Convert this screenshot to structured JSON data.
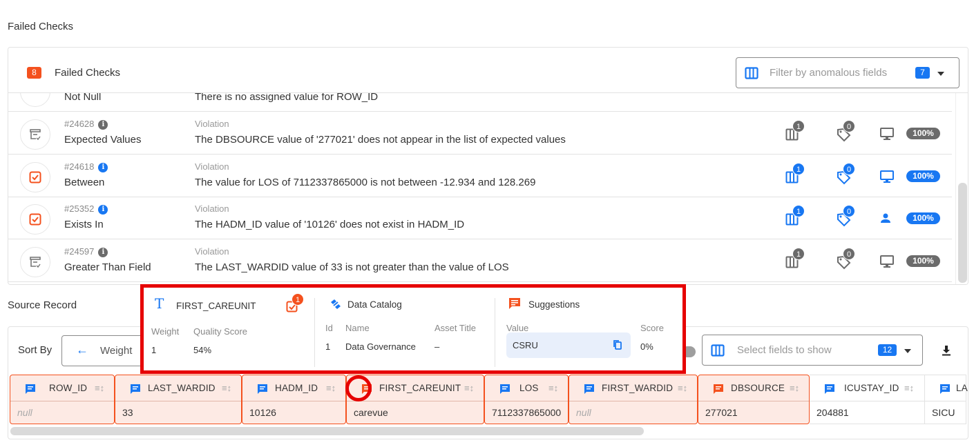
{
  "failed_checks_section": {
    "title": "Failed Checks",
    "header": {
      "count": "8",
      "title": "Failed Checks",
      "filter_placeholder": "Filter by anomalous fields",
      "filter_count": "7"
    },
    "partial_row": {
      "name": "Not Null",
      "violation": "There is no assigned value for ROW_ID"
    },
    "rows": [
      {
        "id": "#24628",
        "name": "Expected Values",
        "violation_label": "Violation",
        "violation": "The DBSOURCE value of '277021' does not appear in the list of expected values",
        "state": "inactive",
        "fields_count": "1",
        "tags_count": "0",
        "owner": "monitor-icon",
        "coverage": "100%"
      },
      {
        "id": "#24618",
        "name": "Between",
        "violation_label": "Violation",
        "violation": "The value for LOS of 7112337865000 is not between -12.934 and 128.269",
        "state": "active",
        "fields_count": "1",
        "tags_count": "0",
        "owner": "monitor-icon",
        "coverage": "100%"
      },
      {
        "id": "#25352",
        "name": "Exists In",
        "violation_label": "Violation",
        "violation": "The HADM_ID value of '10126' does not exist in HADM_ID",
        "state": "active",
        "fields_count": "1",
        "tags_count": "0",
        "owner": "user-icon",
        "coverage": "100%"
      },
      {
        "id": "#24597",
        "name": "Greater Than Field",
        "violation_label": "Violation",
        "violation": "The LAST_WARDID value of 33 is not greater than the value of LOS",
        "state": "inactive",
        "fields_count": "1",
        "tags_count": "0",
        "owner": "monitor-icon",
        "coverage": "100%"
      }
    ]
  },
  "source_record": {
    "title": "Source Record",
    "sort_by_label": "Sort By",
    "sort_value": "Weight",
    "fields_placeholder": "Select fields to show",
    "fields_count": "12",
    "columns": [
      {
        "name": "ROW_ID",
        "value": "null",
        "anomalous": true,
        "is_null": true,
        "icon": "blue"
      },
      {
        "name": "LAST_WARDID",
        "value": "33",
        "anomalous": true,
        "is_null": false,
        "icon": "blue"
      },
      {
        "name": "HADM_ID",
        "value": "10126",
        "anomalous": true,
        "is_null": false,
        "icon": "blue"
      },
      {
        "name": "FIRST_CAREUNIT",
        "value": "carevue",
        "anomalous": true,
        "is_null": false,
        "icon": "orange"
      },
      {
        "name": "LOS",
        "value": "7112337865000",
        "anomalous": true,
        "is_null": false,
        "icon": "blue"
      },
      {
        "name": "FIRST_WARDID",
        "value": "null",
        "anomalous": true,
        "is_null": true,
        "icon": "blue"
      },
      {
        "name": "DBSOURCE",
        "value": "277021",
        "anomalous": true,
        "is_null": false,
        "icon": "orange"
      },
      {
        "name": "ICUSTAY_ID",
        "value": "204881",
        "anomalous": false,
        "is_null": false,
        "icon": "blue"
      },
      {
        "name": "LA",
        "value": "SICU",
        "anomalous": false,
        "is_null": false,
        "icon": "blue"
      }
    ]
  },
  "popover": {
    "field": {
      "name": "FIRST_CAREUNIT",
      "checks_count": "1",
      "weight_label": "Weight",
      "weight": "1",
      "quality_label": "Quality Score",
      "quality": "54%"
    },
    "catalog": {
      "title": "Data Catalog",
      "id_label": "Id",
      "name_label": "Name",
      "asset_label": "Asset Title",
      "id": "1",
      "name": "Data Governance",
      "asset": "–"
    },
    "suggestions": {
      "title": "Suggestions",
      "value_label": "Value",
      "score_label": "Score",
      "value": "CSRU",
      "score": "0%"
    }
  },
  "colors": {
    "accent": "#1877f2",
    "anomaly": "#f4511e",
    "inactive": "#6b6b6b",
    "highlight": "#e60000"
  }
}
